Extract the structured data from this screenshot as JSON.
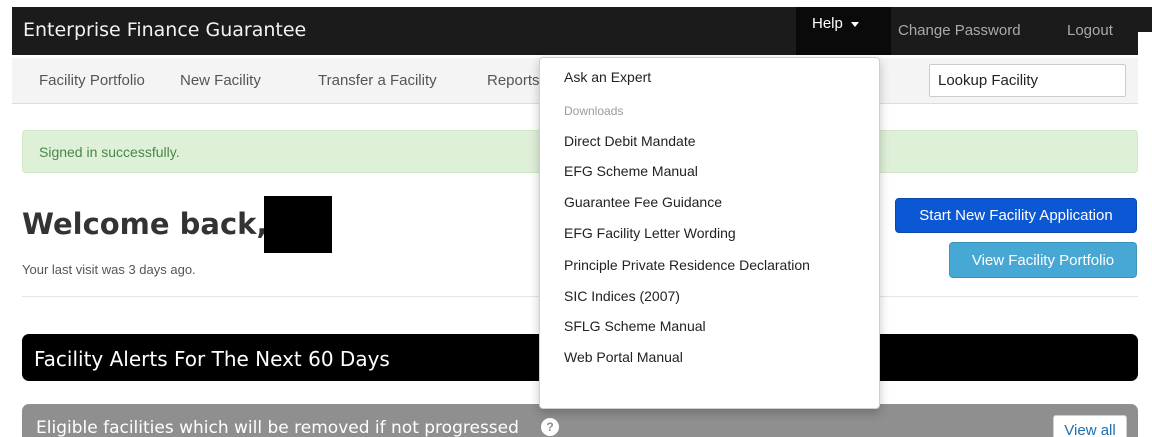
{
  "app": {
    "title": "Enterprise Finance Guarantee"
  },
  "topnav": {
    "help_label": "Help",
    "change_password_label": "Change Password",
    "logout_label": "Logout"
  },
  "subnav": {
    "items": [
      {
        "label": "Facility Portfolio"
      },
      {
        "label": "New Facility"
      },
      {
        "label": "Transfer a Facility"
      },
      {
        "label": "Reports"
      }
    ],
    "lookup_placeholder": "Lookup Facility"
  },
  "flash": {
    "message": "Signed in successfully."
  },
  "welcome": {
    "heading": "Welcome back,",
    "last_visit": "Your last visit was 3 days ago."
  },
  "actions": {
    "start_new_label": "Start New Facility Application",
    "view_portfolio_label": "View Facility Portfolio"
  },
  "alerts": {
    "title": "Facility Alerts For The Next 60 Days",
    "eligible_label": "Eligible facilities which will be removed if not progressed",
    "help_icon_glyph": "?",
    "view_all_label": "View all"
  },
  "help_menu": {
    "ask_expert": "Ask an Expert",
    "downloads_header": "Downloads",
    "items": [
      {
        "label": "Direct Debit Mandate"
      },
      {
        "label": "EFG Scheme Manual"
      },
      {
        "label": "Guarantee Fee Guidance"
      },
      {
        "label": "EFG Facility Letter Wording"
      },
      {
        "label": "Principle Private Residence Declaration"
      },
      {
        "label": "SIC Indices (2007)"
      },
      {
        "label": "SFLG Scheme Manual"
      },
      {
        "label": "Web Portal Manual"
      }
    ]
  },
  "colors": {
    "navbar": "#1b1b1b",
    "primary": "#0c57d3",
    "info": "#47a8d6",
    "success_bg": "#dff0d8",
    "success_text": "#468847"
  }
}
